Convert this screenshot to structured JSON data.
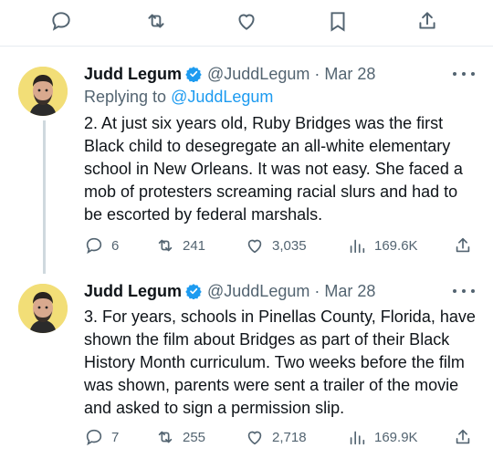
{
  "top_actions": [
    "reply-icon",
    "repost-icon",
    "like-icon",
    "bookmark-icon",
    "share-icon"
  ],
  "tweets": [
    {
      "name": "Judd Legum",
      "handle": "@JuddLegum · Mar 28",
      "replying_prefix": "Replying to ",
      "replying_to": "@JuddLegum",
      "text": "2. At just six years old, Ruby Bridges was the first Black child to desegregate an all-white elementary school in New Orleans. It was not easy. She faced a mob of protesters screaming racial slurs and had to be escorted by federal marshals.",
      "replies": "6",
      "reposts": "241",
      "likes": "3,035",
      "views": "169.6K"
    },
    {
      "name": "Judd Legum",
      "handle": "@JuddLegum · Mar 28",
      "text": "3. For years, schools in Pinellas County, Florida, have shown the film about Bridges as part of their Black History Month curriculum. Two weeks before the film was shown, parents were sent a trailer of the movie and asked to sign a permission slip.",
      "replies": "7",
      "reposts": "255",
      "likes": "2,718",
      "views": "169.9K"
    }
  ],
  "colors": {
    "text": "#0f1419",
    "muted": "#536471",
    "accent": "#1d9bf0",
    "thread_line": "#cfd9de"
  }
}
